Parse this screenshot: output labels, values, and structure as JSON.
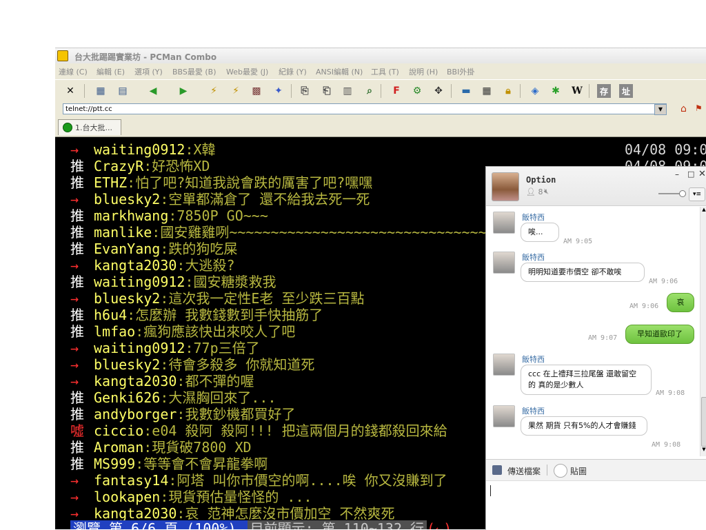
{
  "window": {
    "title": "台大批踢踢實業坊 - PCMan Combo"
  },
  "menu": [
    "連線 (C)",
    "編輯 (E)",
    "選項 (Y)",
    "BBS最愛 (B)",
    "Web最愛 (J)",
    "紀錄 (Y)",
    "ANSI編輯 (N)",
    "工具 (T)",
    "說明 (H)",
    "BBI外掛"
  ],
  "address": {
    "value": "telnet://ptt.cc"
  },
  "tabs": [
    {
      "label": "1.台大批..."
    }
  ],
  "terminal": {
    "lines": [
      {
        "tag": "→",
        "user": "waiting0912",
        "msg": ":X韓",
        "time": "04/08 09:0"
      },
      {
        "tag": "推",
        "user": "CrazyR",
        "msg": ":好恐怖XD",
        "time": "04/08 09:0"
      },
      {
        "tag": "推",
        "user": "ETHZ",
        "msg": ":怕了吧?知道我說會跌的厲害了吧?嘿嘿",
        "time": ""
      },
      {
        "tag": "→",
        "user": "bluesky2",
        "msg": ":空單都滿倉了 還不給我去死一死",
        "time": ""
      },
      {
        "tag": "推",
        "user": "markhwang",
        "msg": ":7850P GO~~~",
        "time": ""
      },
      {
        "tag": "推",
        "user": "manlike",
        "msg": ":國安雞雞咧~~~~~~~~~~~~~~~~~~~~~~~~~~~~~~~~~~~~~~~~~~~",
        "time": ""
      },
      {
        "tag": "推",
        "user": "EvanYang",
        "msg": ":跌的狗吃屎",
        "time": ""
      },
      {
        "tag": "→",
        "user": "kangta2030",
        "msg": ":大逃殺?",
        "time": ""
      },
      {
        "tag": "推",
        "user": "waiting0912",
        "msg": ":國安糖漿救我",
        "time": ""
      },
      {
        "tag": "→",
        "user": "bluesky2",
        "msg": ":這次我一定性E老 至少跌三百點",
        "time": ""
      },
      {
        "tag": "推",
        "user": "h6u4",
        "msg": ":怎麼辦 我數錢數到手快抽筋了",
        "time": ""
      },
      {
        "tag": "推",
        "user": "lmfao",
        "msg": ":瘋狗應該快出來咬人了吧",
        "time": ""
      },
      {
        "tag": "→",
        "user": "waiting0912",
        "msg": ":77p三倍了",
        "time": ""
      },
      {
        "tag": "→",
        "user": "bluesky2",
        "msg": ":待會多殺多 你就知道死",
        "time": ""
      },
      {
        "tag": "→",
        "user": "kangta2030",
        "msg": ":都不彈的喔",
        "time": ""
      },
      {
        "tag": "推",
        "user": "Genki626",
        "msg": ":大濕胸回來了...",
        "time": ""
      },
      {
        "tag": "推",
        "user": "andyborger",
        "msg": ":我數鈔機都買好了",
        "time": ""
      },
      {
        "tag": "噓",
        "user": "ciccio",
        "msg": ":e04 殺阿 殺阿!!! 把這兩個月的錢都殺回來給",
        "time": ""
      },
      {
        "tag": "推",
        "user": "Aroman",
        "msg": ":現貨破7800 XD",
        "time": ""
      },
      {
        "tag": "推",
        "user": "MS999",
        "msg": ":等等會不會昇龍拳啊",
        "time": ""
      },
      {
        "tag": "→",
        "user": "fantasy14",
        "msg": ":阿塔 叫你市價空的啊....唉 你又沒賺到了",
        "time": ""
      },
      {
        "tag": "→",
        "user": "lookapen",
        "msg": ":現貨預估量怪怪的 ...",
        "time": ""
      },
      {
        "tag": "→",
        "user": "kangta2030",
        "msg": ":哀 范神怎麼沒市價加空 不然爽死",
        "time": ""
      }
    ],
    "status_a": " 瀏覽 第 6/6 頁 (100%) ",
    "status_b": " 目前顯示: 第 110~132 行",
    "status_c": "(←)"
  },
  "chat": {
    "name": "Option",
    "member_count": "8",
    "messages": [
      {
        "from": "飯特西",
        "text": "唉...",
        "time": "AM 9:05",
        "me": false
      },
      {
        "from": "飯特西",
        "text": "明明知道要市價空 卻不敢唉",
        "time": "AM 9:06",
        "me": false
      },
      {
        "from": "",
        "text": "哀",
        "time": "AM 9:06",
        "me": true
      },
      {
        "from": "",
        "text": "早知道歐印了",
        "time": "AM 9:07",
        "me": true
      },
      {
        "from": "飯特西",
        "text": "ccc 在上禮拜三拉尾盤 還敢留空的 真的是少數人",
        "time": "AM 9:08",
        "me": false
      },
      {
        "from": "飯特西",
        "text": "果然 期貨 只有5%的人才會賺錢",
        "time": "AM 9:08",
        "me": false
      }
    ],
    "send_file": "傳送檔案",
    "sticker": "貼圖"
  },
  "colors": {
    "terminal_bg": "#000000",
    "user_color": "#ffff66",
    "msg_color": "#b8b840",
    "arrow_color": "#ff3030",
    "bubble_me": "#8ed65a"
  }
}
